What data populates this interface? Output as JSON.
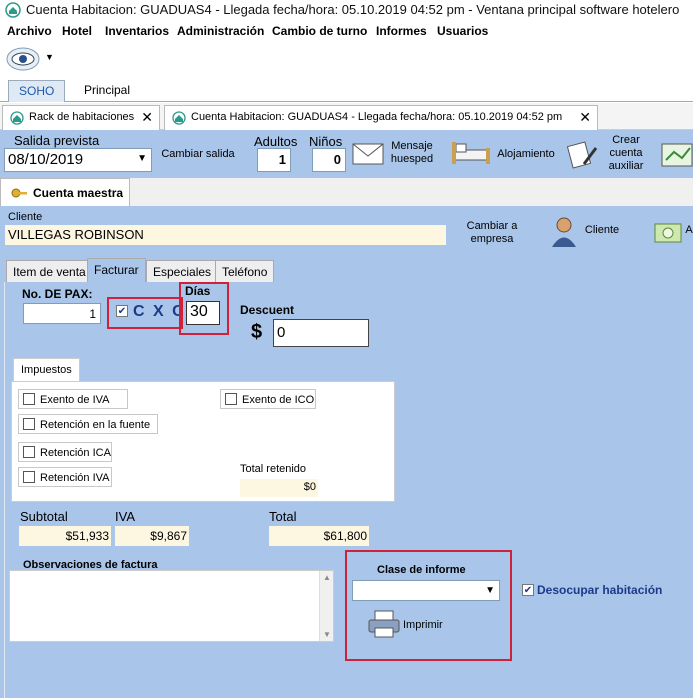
{
  "window": {
    "title": "Cuenta Habitacion:   GUADUAS4  -  Llegada fecha/hora:  05.10.2019 04:52 pm - Ventana principal software hotelero"
  },
  "menu": [
    "Archivo",
    "Hotel",
    "Inventarios",
    "Administración",
    "Cambio de turno",
    "Informes",
    "Usuarios"
  ],
  "ribbon_tabs": [
    "SOHO",
    "Principal"
  ],
  "doc_tabs": [
    "Rack de habitaciones",
    "Cuenta Habitacion:   GUADUAS4  -  Llegada fecha/hora:  05.10.2019 04:52 pm"
  ],
  "header": {
    "salida_label": "Salida prevista",
    "salida_value": "08/10/2019",
    "cambiar_salida": "Cambiar salida",
    "adultos_label": "Adultos",
    "adultos_value": "1",
    "ninos_label": "Niños",
    "ninos_value": "0",
    "mensaje_line1": "Mensaje",
    "mensaje_line2": "huesped",
    "alojamiento": "Alojamiento",
    "crear_line1": "Crear",
    "crear_line2": "cuenta",
    "crear_line3": "auxiliar"
  },
  "cuenta_maestra": "Cuenta maestra",
  "cliente": {
    "label": "Cliente",
    "value": "VILLEGAS ROBINSON",
    "cambiar_line1": "Cambiar a",
    "cambiar_line2": "empresa",
    "cliente_btn": "Cliente",
    "a_btn": "A"
  },
  "inner_tabs": [
    "Item de venta",
    "Facturar",
    "Especiales",
    "Teléfono"
  ],
  "facturar": {
    "pax_label": "No. DE PAX:",
    "pax_value": "1",
    "cxc": "C X C",
    "dias_label": "Días",
    "dias_value": "30",
    "descuento_label": "Descuent",
    "dollar": "$",
    "descuento_value": "0"
  },
  "impuestos": {
    "tab": "Impuestos",
    "exento_iva": "Exento de IVA",
    "exento_ico": "Exento de ICO",
    "retencion_fuente": "Retención en la fuente",
    "retencion_ica": "Retención ICA",
    "retencion_iva": "Retención IVA",
    "total_retenido_label": "Total retenido",
    "total_retenido_value": "$0"
  },
  "totales": {
    "subtotal_label": "Subtotal",
    "subtotal_value": "$51,933",
    "iva_label": "IVA",
    "iva_value": "$9,867",
    "total_label": "Total",
    "total_value": "$61,800"
  },
  "observaciones_label": "Observaciones de factura",
  "informe": {
    "label": "Clase de informe",
    "imprimir": "Imprimir",
    "desocupar": "Desocupar habitación"
  }
}
